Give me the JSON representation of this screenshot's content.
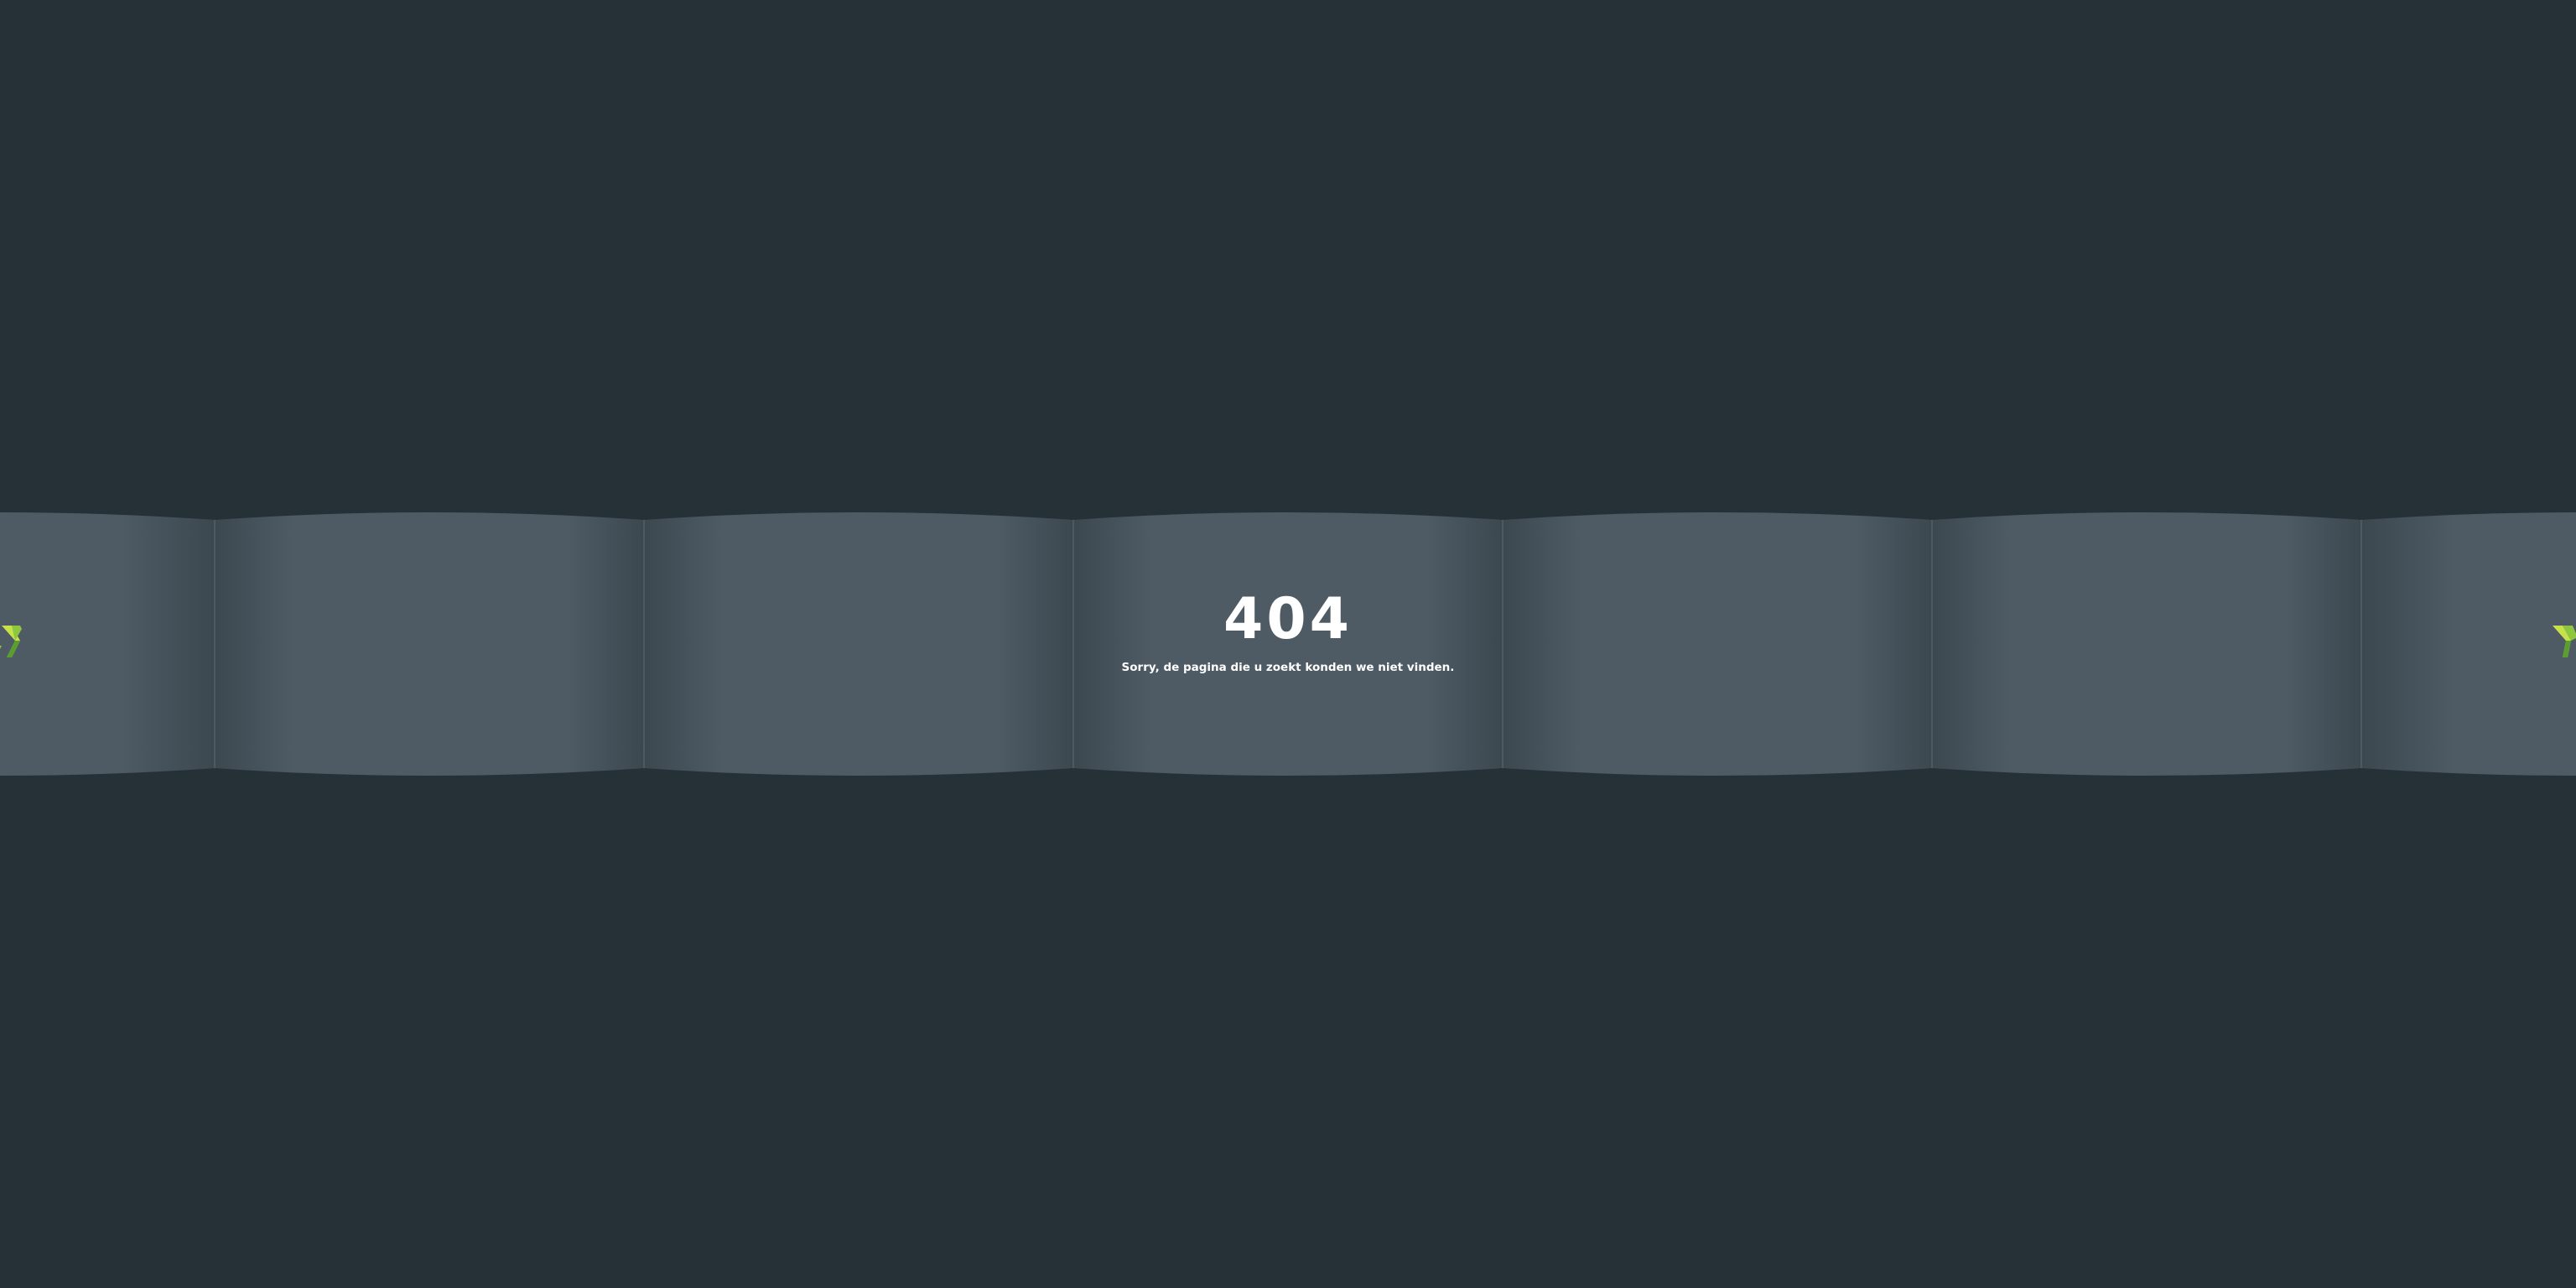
{
  "error": {
    "code": "404",
    "message": "Sorry, de pagina die u zoekt konden we niet vinden."
  },
  "decor": {
    "band_color": "#4e5b64",
    "band_shadow": "#3a454d",
    "background": "#263037",
    "logo_icon": "green-chevron-logo-icon",
    "logo_colors": [
      "#8dc63f",
      "#c8e04a",
      "#5a9e2f"
    ]
  }
}
